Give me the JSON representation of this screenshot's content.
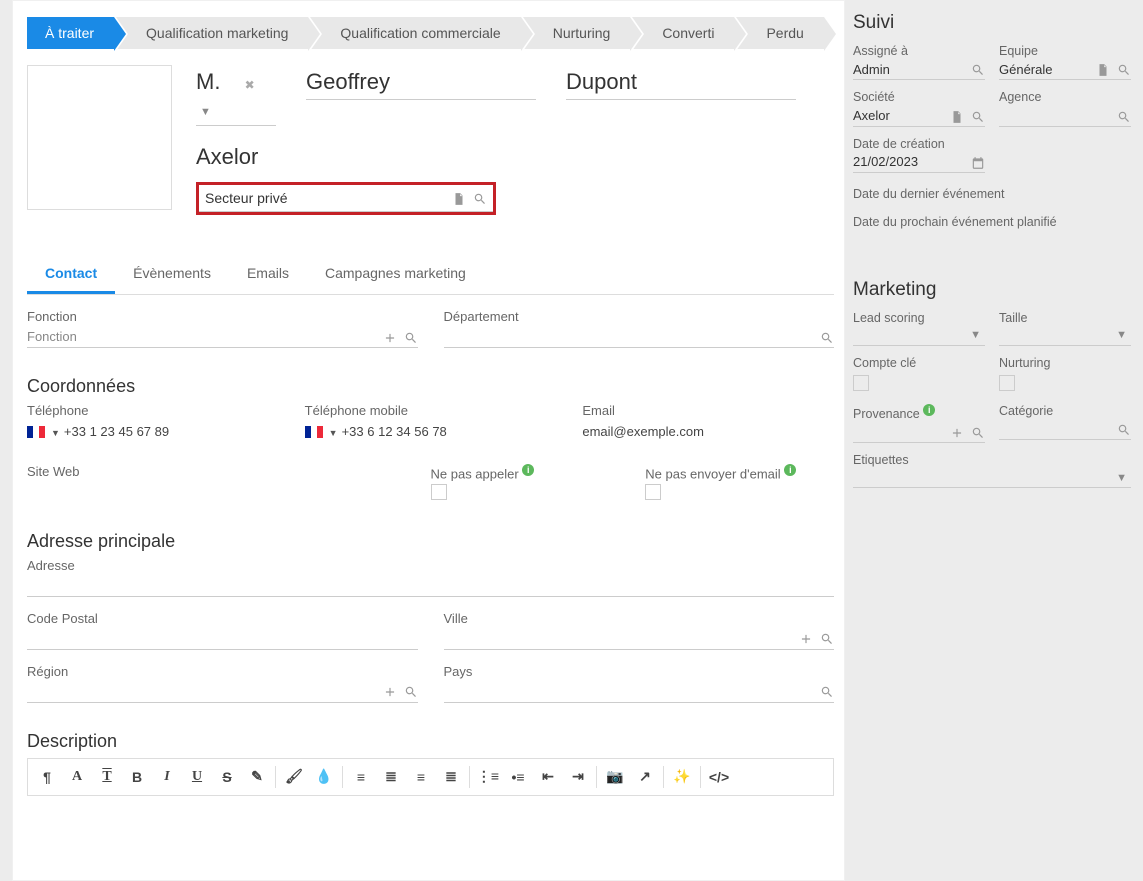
{
  "stages": [
    "À traiter",
    "Qualification marketing",
    "Qualification commerciale",
    "Nurturing",
    "Converti",
    "Perdu"
  ],
  "active_stage": 0,
  "header": {
    "title": "M.",
    "first_name": "Geoffrey",
    "last_name": "Dupont",
    "company": "Axelor",
    "sector": "Secteur privé"
  },
  "tabs": [
    "Contact",
    "Évènements",
    "Emails",
    "Campagnes marketing"
  ],
  "active_tab": 0,
  "labels": {
    "fonction": "Fonction",
    "fonction_ph": "Fonction",
    "departement": "Département",
    "coordonnees": "Coordonnées",
    "telephone": "Téléphone",
    "tel_val": "+33 1 23 45 67 89",
    "tel_mobile": "Téléphone mobile",
    "tel_mobile_val": "+33 6 12 34 56 78",
    "email": "Email",
    "email_val": "email@exemple.com",
    "site": "Site Web",
    "nepas_appeler": "Ne pas appeler",
    "nepas_email": "Ne pas envoyer d'email",
    "adresse_section": "Adresse principale",
    "adresse": "Adresse",
    "cp": "Code Postal",
    "ville": "Ville",
    "region": "Région",
    "pays": "Pays",
    "description": "Description"
  },
  "side": {
    "suivi": "Suivi",
    "assigne": "Assigné à",
    "assigne_val": "Admin",
    "equipe": "Equipe",
    "equipe_val": "Générale",
    "societe": "Société",
    "societe_val": "Axelor",
    "agence": "Agence",
    "date_creation": "Date de création",
    "date_creation_val": "21/02/2023",
    "dernier_event": "Date du dernier événement",
    "prochain_event": "Date du prochain événement planifié",
    "marketing": "Marketing",
    "lead_scoring": "Lead scoring",
    "taille": "Taille",
    "compte_cle": "Compte clé",
    "nurturing": "Nurturing",
    "provenance": "Provenance",
    "categorie": "Catégorie",
    "etiquettes": "Etiquettes"
  }
}
